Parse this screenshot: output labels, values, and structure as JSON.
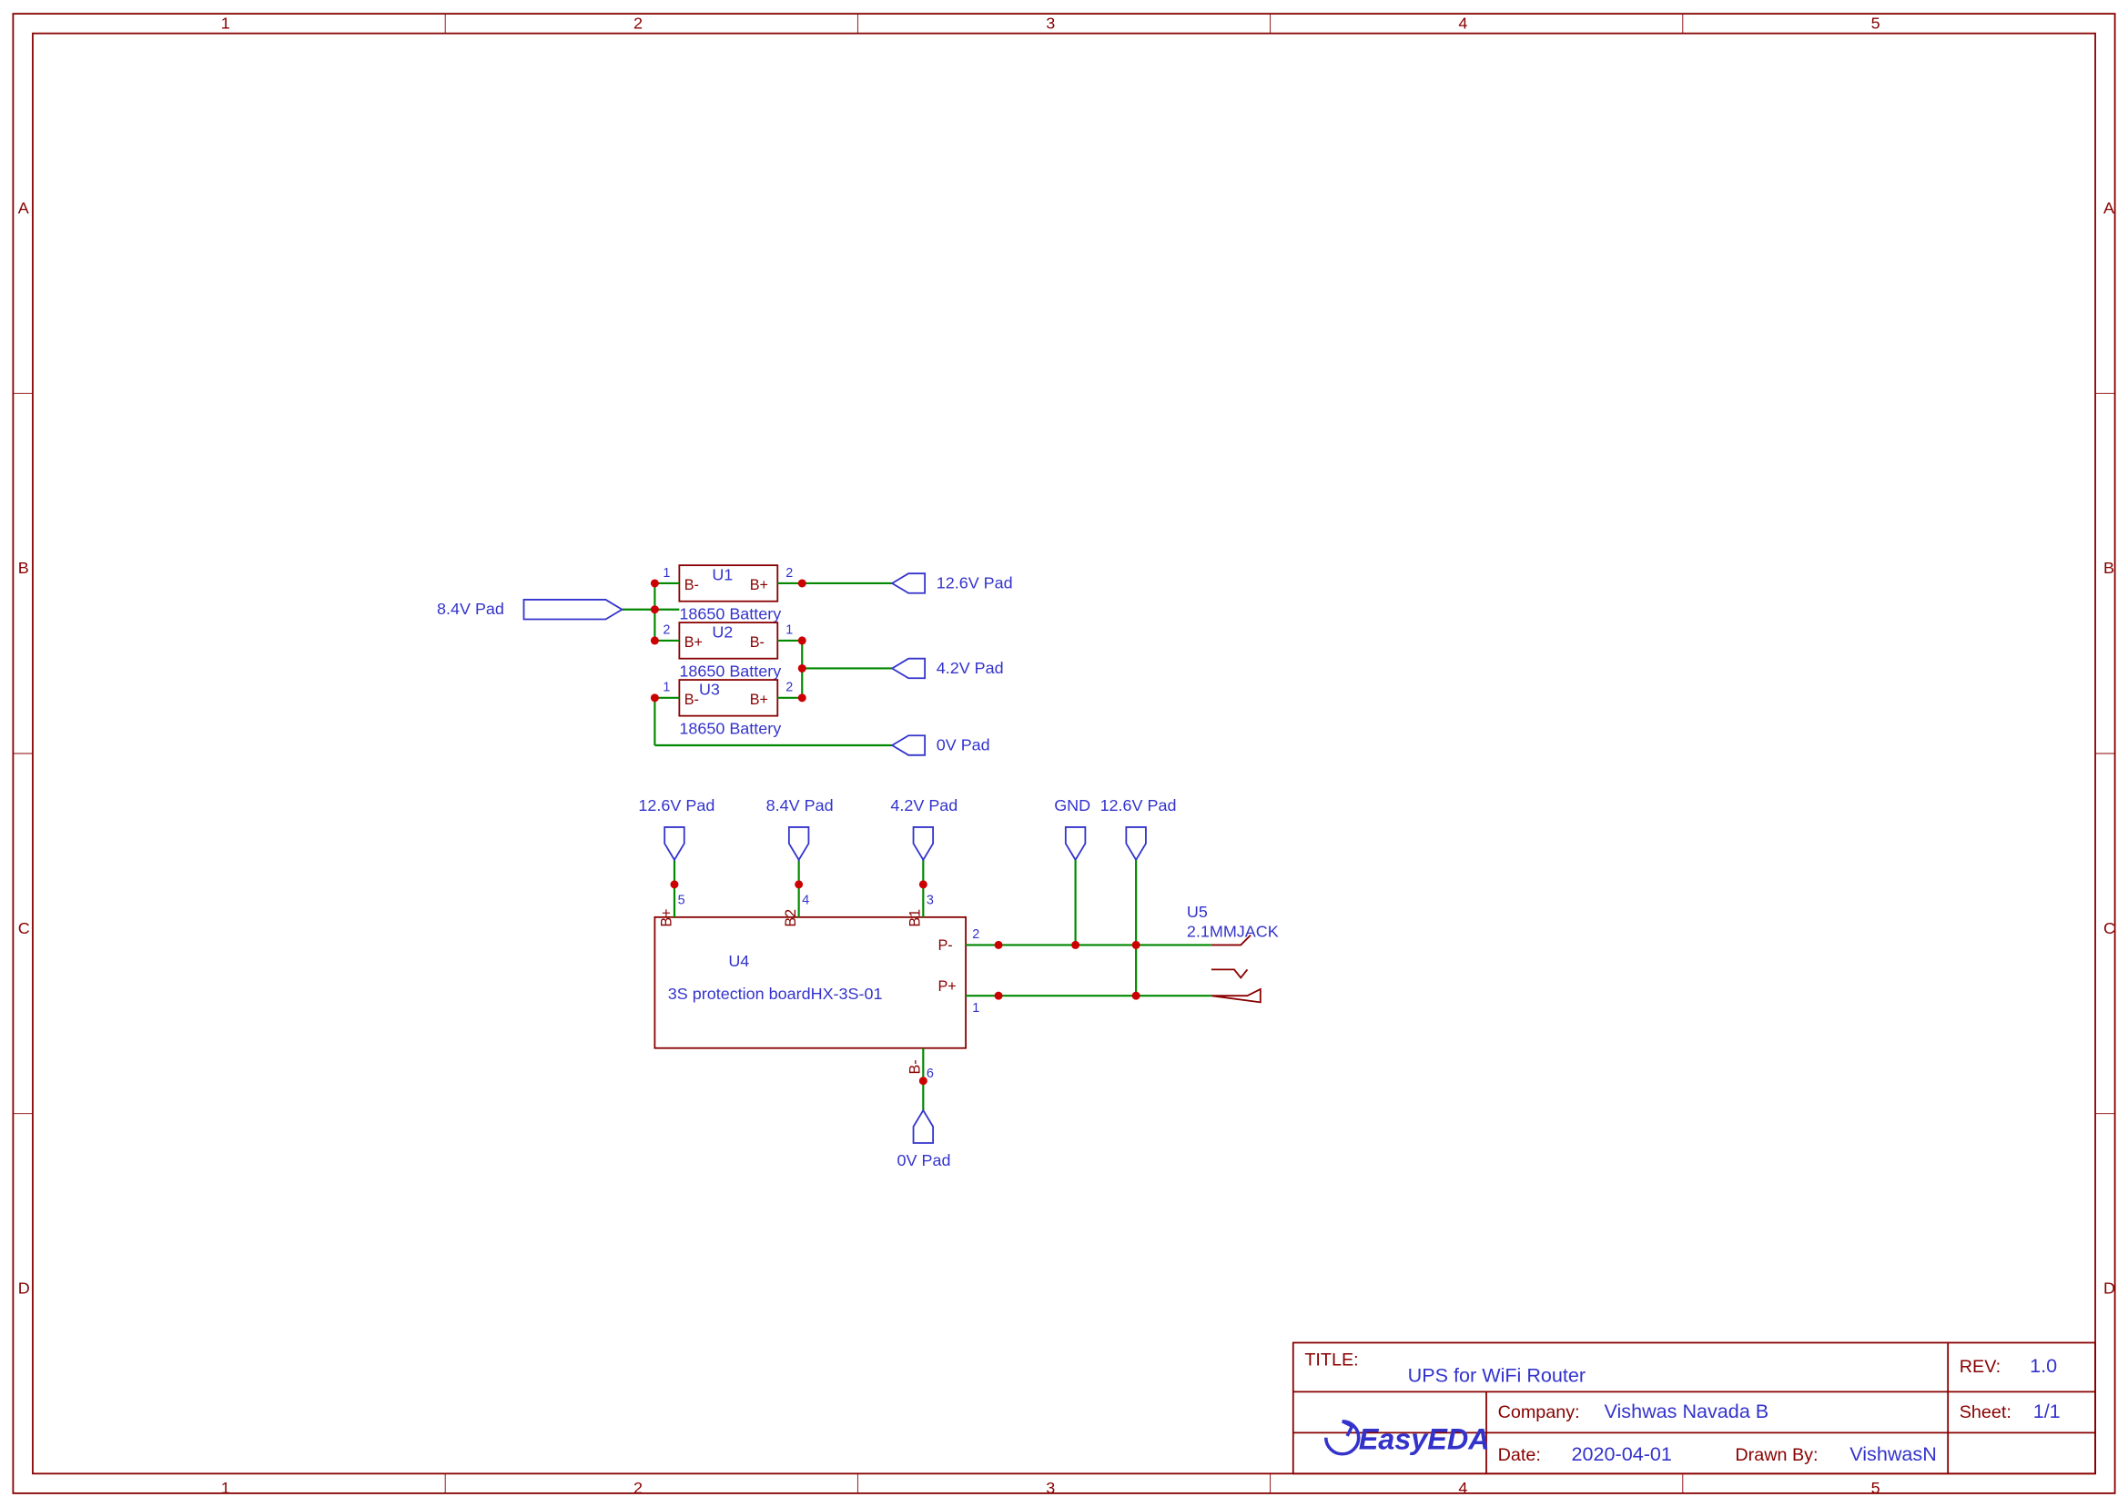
{
  "frame": {
    "cols": [
      "1",
      "2",
      "3",
      "4",
      "5"
    ],
    "rows": [
      "A",
      "B",
      "C",
      "D"
    ]
  },
  "batteries": {
    "u1": {
      "ref": "U1",
      "desc": "18650 Battery",
      "pins": {
        "left": "B-",
        "right": "B+",
        "ln": "1",
        "rn": "2"
      }
    },
    "u2": {
      "ref": "U2",
      "desc": "18650 Battery",
      "pins": {
        "left": "B+",
        "right": "B-",
        "ln": "2",
        "rn": "1"
      }
    },
    "u3": {
      "ref": "U3",
      "desc": "18650 Battery",
      "pins": {
        "left": "B-",
        "right": "B+",
        "ln": "1",
        "rn": "2"
      }
    }
  },
  "nets": {
    "pad_12_6": "12.6V Pad",
    "pad_8_4": "8.4V Pad",
    "pad_4_2": "4.2V Pad",
    "pad_0": "0V Pad",
    "gnd": "GND"
  },
  "u4": {
    "ref": "U4",
    "desc": "3S protection boardHX-3S-01",
    "pins": {
      "bplus": "B+",
      "b2": "B2",
      "b1": "B1",
      "pminus": "P-",
      "pplus": "P+",
      "bminus": "B-",
      "n5": "5",
      "n4": "4",
      "n3": "3",
      "n2": "2",
      "n1": "1",
      "n6": "6"
    }
  },
  "u5": {
    "ref": "U5",
    "desc": "2.1MMJACK"
  },
  "titleblock": {
    "title_key": "TITLE:",
    "title_val": "UPS for WiFi Router",
    "rev_key": "REV:",
    "rev_val": "1.0",
    "company_key": "Company:",
    "company_val": "Vishwas Navada B",
    "sheet_key": "Sheet:",
    "sheet_val": "1/1",
    "date_key": "Date:",
    "date_val": "2020-04-01",
    "drawn_key": "Drawn By:",
    "drawn_val": "VishwasN",
    "logo": "EasyEDA"
  }
}
